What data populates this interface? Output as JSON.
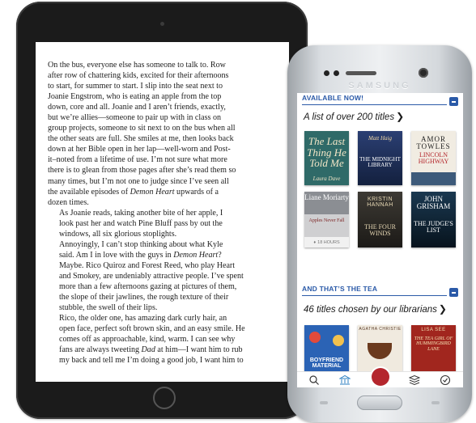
{
  "ereader": {
    "paragraphs": [
      [
        "On the bus, everyone else has someone to talk to. Row",
        "after row of chattering kids, excited for their afternoons",
        "to start, for summer to start. I slip into the seat next to",
        "Joanie Engstrom, who is eating an apple from the top",
        "down, core and all. Joanie and I aren’t friends, exactly,",
        "but we’re allies—someone to pair up with in class on",
        "group projects, someone to sit next to on the bus when all",
        "the other seats are full. She smiles at me, then looks back",
        "down at her Bible open in her lap—well-worn and Post-",
        "it–noted from a lifetime of use. I’m not sure what more",
        "there is to glean from those pages after she’s read them so",
        "many times, but I’m not one to judge since I’ve seen all",
        "the available episodes of ",
        "dozen times."
      ],
      [
        "As Joanie reads, taking another bite of her apple, I",
        "look past her and watch Pine Bluff pass by out the",
        "windows, all six glorious stoplights."
      ],
      [
        "Annoyingly, I can’t stop thinking about what Kyle",
        "said. Am I in love with the guys in ",
        "Maybe. Rico Quiroz and Forest Reed, who play Heart",
        "and Smokey, are undeniably attractive people. I’ve spent",
        "more than a few afternoons gazing at pictures of them,",
        "the slope of their jawlines, the rough texture of their",
        "stubble, the swell of their lips."
      ],
      [
        "Rico, the older one, has amazing dark curly hair, an",
        "open face, perfect soft brown skin, and an easy smile. He",
        "comes off as approachable, kind, warm. I can see why",
        "fans are always tweeting ",
        "my back and tell me I’m doing a good job, I want him to"
      ]
    ],
    "italic_demon_heart": "Demon Heart",
    "upwards_suffix": " upwards of a",
    "demon_heart_q": "Demon Heart",
    "q_suffix": "?",
    "dad": "Dad",
    "dad_suffix": " at him—I want him to rub"
  },
  "phone": {
    "brand": "SAMSUNG",
    "section1": {
      "header": "AVAILABLE NOW!",
      "title": "A list of over 200 titles",
      "books_row1": [
        {
          "title": "The Last Thing He Told Me",
          "author": "Laura Dave",
          "bg": "#2f6a68"
        },
        {
          "title": "THE MIDNIGHT LIBRARY",
          "author": "Matt Haig",
          "bg": "#1f2b52"
        },
        {
          "title": "LINCOLN HIGHWAY",
          "author": "AMOR TOWLES",
          "bg": "#f1ece2"
        }
      ],
      "books_row2": [
        {
          "title": "Apples Never Fall",
          "author": "Liane Moriarty",
          "bg": "#cfcfd1"
        },
        {
          "title": "THE FOUR WINDS",
          "author": "KRISTIN HANNAH",
          "bg": "#2d2a26"
        },
        {
          "title": "THE JUDGE'S LIST",
          "author": "JOHN GRISHAM",
          "bg": "#0f2233"
        }
      ],
      "hold_badge": "18 HOURS"
    },
    "section2": {
      "header": "AND THAT’S THE TEA",
      "title": "46 titles chosen by our librarians",
      "books": [
        {
          "title": "BOYFRIEND MATERIAL",
          "bg": "#2b63b5"
        },
        {
          "title": "AGATHA CHRISTIE",
          "bg": "#5a3c2a"
        },
        {
          "title": "THE TEA GIRL OF HUMMINGBIRD LANE",
          "author": "LISA SEE",
          "bg": "#a1261e"
        }
      ]
    },
    "nav": [
      "search-icon",
      "library-icon",
      "avatar",
      "books-icon",
      "check-icon"
    ]
  }
}
